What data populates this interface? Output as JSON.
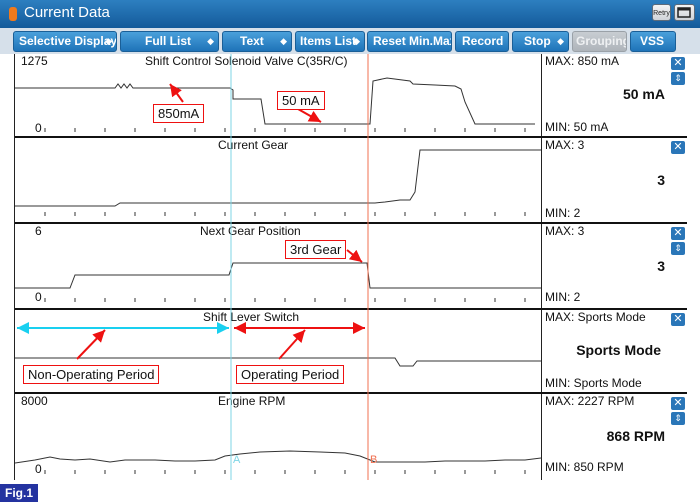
{
  "window": {
    "title": "Current Data"
  },
  "toolbar": {
    "selective_display": "Selective Display",
    "full_list": "Full List",
    "text": "Text",
    "items_list": "Items List",
    "reset_minmax": "Reset Min.Max",
    "record": "Record",
    "stop": "Stop",
    "grouping": "Grouping",
    "vss": "VSS"
  },
  "panels": [
    {
      "title": "Shift Control Solenoid Valve C(35R/C)",
      "top_label": "1275",
      "bottom_label": "0",
      "max": "MAX:   850 mA",
      "min": "MIN:   50 mA",
      "current": "50 mA"
    },
    {
      "title": "Current Gear",
      "top_label": "",
      "bottom_label": "",
      "max": "MAX: 3",
      "min": "MIN: 2",
      "current": "3"
    },
    {
      "title": "Next Gear Position",
      "top_label": "6",
      "bottom_label": "0",
      "max": "MAX:     3",
      "min": "MIN:     2",
      "current": "3"
    },
    {
      "title": "Shift Lever Switch",
      "top_label": "",
      "bottom_label": "",
      "max": "MAX: Sports Mode",
      "min": "MIN: Sports Mode",
      "current": "Sports Mode"
    },
    {
      "title": "Engine RPM",
      "top_label": "8000",
      "bottom_label": "0",
      "max": "MAX:  2227 RPM",
      "min": "MIN:   850 RPM",
      "current": "868 RPM"
    }
  ],
  "annotations": {
    "c850": "850mA",
    "c50": "50 mA",
    "c3rd": "3rd Gear",
    "non_op": "Non-Operating Period",
    "op": "Operating Period",
    "marker_a": "A",
    "marker_b": "B"
  },
  "controls": {
    "close": "✕",
    "scroll": "⇕",
    "retry": "Retry"
  },
  "figure": {
    "label": "Fig.1"
  },
  "colors": {
    "marker_a": "#7fd6e6",
    "marker_b": "#f07050",
    "callout": "#e11111",
    "arrow_cyan": "#19d0f0"
  }
}
